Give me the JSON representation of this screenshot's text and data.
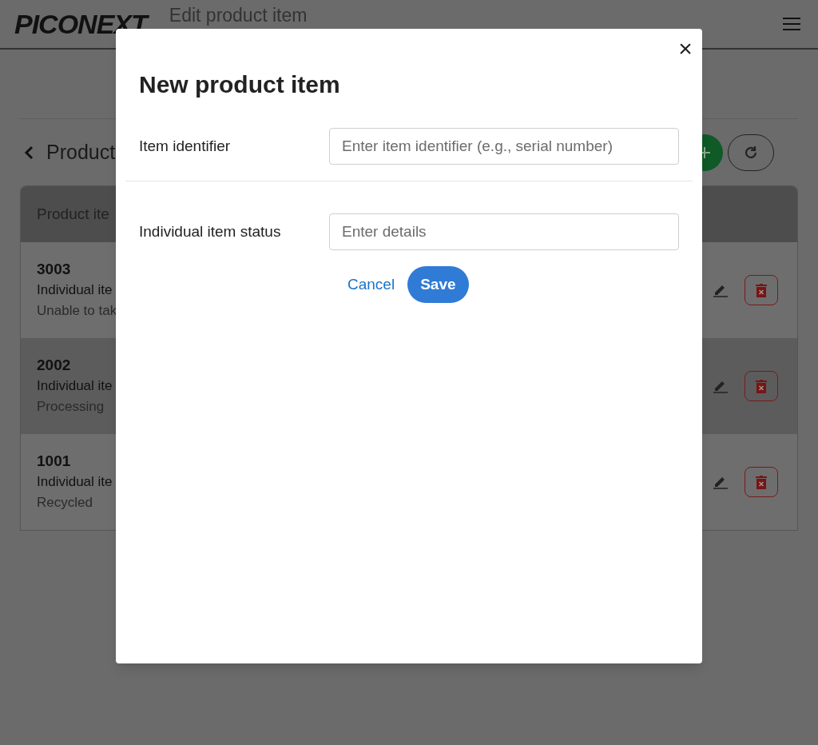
{
  "header": {
    "logo": "PICONEXT",
    "title": "Edit product item"
  },
  "page": {
    "back_label": "Product"
  },
  "table": {
    "header": "Product ite",
    "rows": [
      {
        "id": "3003",
        "line_1": "Individual ite",
        "line_2": "Unable to tak",
        "highlighted": false
      },
      {
        "id": "2002",
        "line_1": "Individual ite",
        "line_2": "Processing",
        "highlighted": true
      },
      {
        "id": "1001",
        "line_1": "Individual ite",
        "line_2": "Recycled",
        "highlighted": false
      }
    ]
  },
  "modal": {
    "title": "New product item",
    "close": "×",
    "fields": [
      {
        "label": "Item identifier",
        "placeholder": "Enter item identifier (e.g., serial number)"
      },
      {
        "label": "Individual item status",
        "placeholder": "Enter details"
      }
    ],
    "cancel": "Cancel",
    "save": "Save"
  }
}
